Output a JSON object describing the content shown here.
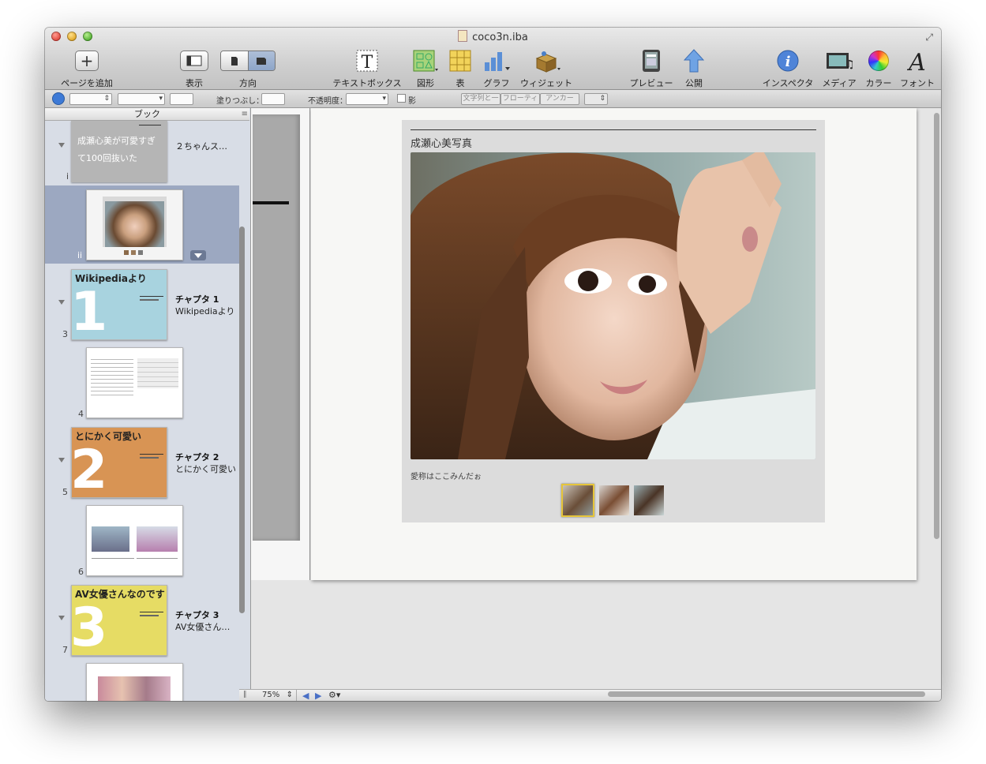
{
  "window": {
    "title": "coco3n.iba"
  },
  "toolbar": {
    "add_page": "ページを追加",
    "view": "表示",
    "orientation": "方向",
    "textbox": "テキストボックス",
    "shapes": "図形",
    "table": "表",
    "chart": "グラフ",
    "widget": "ウィジェット",
    "preview": "プレビュー",
    "publish": "公開",
    "inspector": "インスペクタ",
    "media": "メディア",
    "colors": "カラー",
    "fonts": "フォント"
  },
  "formatbar": {
    "fill_label": "塗りつぶし：",
    "opacity_label": "不透明度：",
    "shadow_label": "影",
    "wrap_inline": "文字列と一",
    "floating": "フローティ",
    "anchor": "アンカー"
  },
  "sidebar": {
    "header": "ブック",
    "intro": {
      "title": "成瀬心美が可愛すぎて100回抜いた",
      "label": "２ちゃんス…",
      "num": "i"
    },
    "selected_num": "ii",
    "chapters": [
      {
        "thumb_title": "Wikipediaより",
        "digit": "1",
        "title": "チャプタ 1",
        "sub": "Wikipediaより",
        "num": "3",
        "next_num": "4",
        "color": "#a8d3df"
      },
      {
        "thumb_title": "とにかく可愛い",
        "digit": "2",
        "title": "チャプタ 2",
        "sub": "とにかく可愛い",
        "num": "5",
        "next_num": "6",
        "color": "#d89454"
      },
      {
        "thumb_title": "AV女優さんなのです",
        "digit": "3",
        "title": "チャプタ 3",
        "sub": "AV女優さん…",
        "num": "7",
        "next_num": "",
        "color": "#e6dc64"
      }
    ]
  },
  "page": {
    "gallery_title": "成瀬心美写真",
    "caption": "愛称はここみんだぉ"
  },
  "bottombar": {
    "zoom": "75%"
  }
}
